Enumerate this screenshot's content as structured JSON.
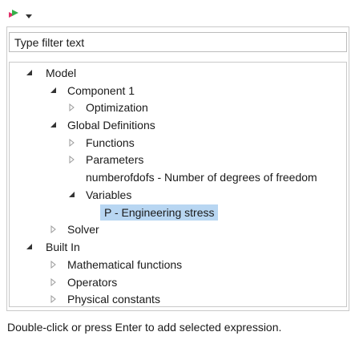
{
  "filter": {
    "placeholder": "Type filter text"
  },
  "tree": {
    "model": "Model",
    "component1": "Component 1",
    "optimization": "Optimization",
    "global_definitions": "Global Definitions",
    "functions": "Functions",
    "parameters": "Parameters",
    "numberofdofs": "numberofdofs - Number of degrees of freedom",
    "variables": "Variables",
    "p_engineering_stress": "P - Engineering stress",
    "solver": "Solver",
    "built_in": "Built In",
    "mathematical_functions": "Mathematical functions",
    "operators": "Operators",
    "physical_constants": "Physical constants"
  },
  "status": {
    "text": "Double-click or press Enter to add selected expression."
  },
  "colors": {
    "selection": "#b8d6f2",
    "border": "#c9c9c9"
  }
}
